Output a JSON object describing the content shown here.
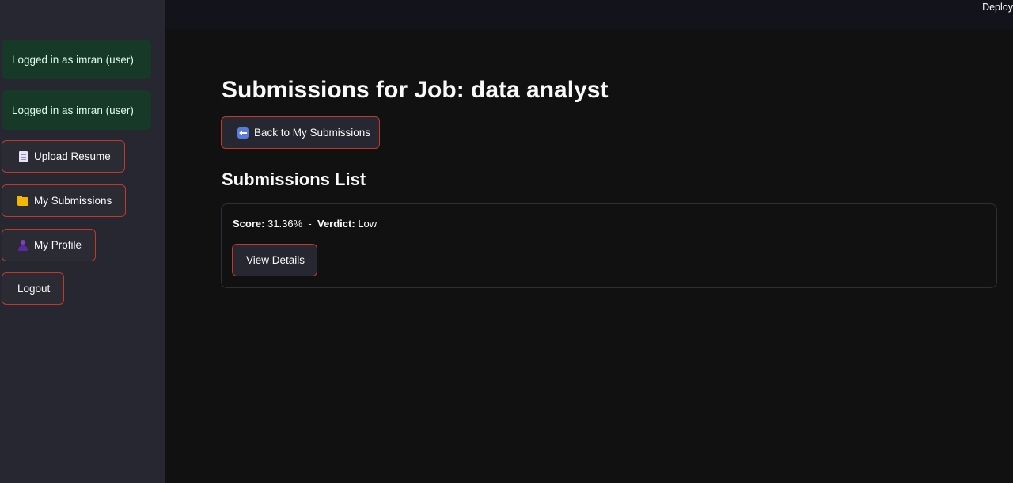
{
  "header": {
    "deploy_label": "Deploy"
  },
  "sidebar": {
    "alerts": [
      "Logged in as imran (user)",
      "Logged in as imran (user)"
    ],
    "buttons": {
      "upload": {
        "label": "Upload Resume",
        "icon": "document-icon"
      },
      "submissions": {
        "label": "My Submissions",
        "icon": "folder-icon"
      },
      "profile": {
        "label": "My Profile",
        "icon": "person-icon"
      },
      "logout": {
        "label": "Logout"
      }
    }
  },
  "main": {
    "title": "Submissions for Job: data analyst",
    "back_button": {
      "label": "Back to My Submissions",
      "icon": "back-arrow-icon"
    },
    "section_title": "Submissions List",
    "submission": {
      "score_label": "Score:",
      "score_value": "31.36%",
      "separator": " - ",
      "verdict_label": "Verdict:",
      "verdict_value": "Low",
      "details_button": "View Details"
    }
  },
  "colors": {
    "background": "#111111",
    "sidebar": "#262730",
    "header": "#12131b",
    "alert_bg": "#173928",
    "button_border": "#c0392b"
  }
}
